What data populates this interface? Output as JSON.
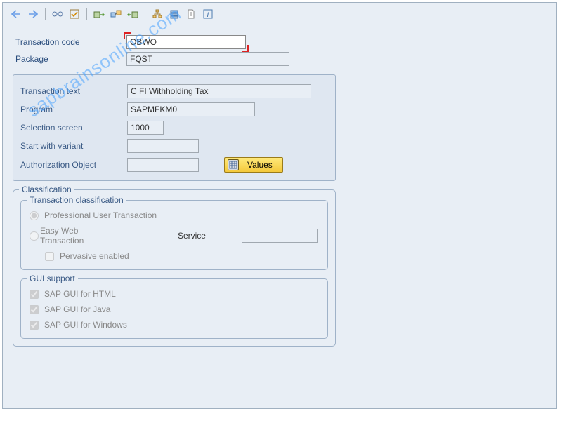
{
  "watermark": "sapbrainsonline.com",
  "fields": {
    "transaction_code": {
      "label": "Transaction code",
      "value": "OBWO"
    },
    "package": {
      "label": "Package",
      "value": "FQST"
    },
    "transaction_text": {
      "label": "Transaction text",
      "value": "C FI Withholding Tax"
    },
    "program": {
      "label": "Program",
      "value": "SAPMFKM0"
    },
    "selection_screen": {
      "label": "Selection screen",
      "value": "1000"
    },
    "start_with_variant": {
      "label": "Start with variant",
      "value": ""
    },
    "authorization_object": {
      "label": "Authorization Object",
      "value": ""
    }
  },
  "buttons": {
    "values": "Values"
  },
  "classification": {
    "legend": "Classification",
    "tx_class_legend": "Transaction classification",
    "professional": "Professional User Transaction",
    "easy_web": "Easy Web Transaction",
    "service_label": "Service",
    "service_value": "",
    "pervasive": "Pervasive enabled",
    "gui_legend": "GUI support",
    "gui_html": "SAP GUI for HTML",
    "gui_java": "SAP GUI for Java",
    "gui_windows": "SAP GUI for Windows"
  }
}
